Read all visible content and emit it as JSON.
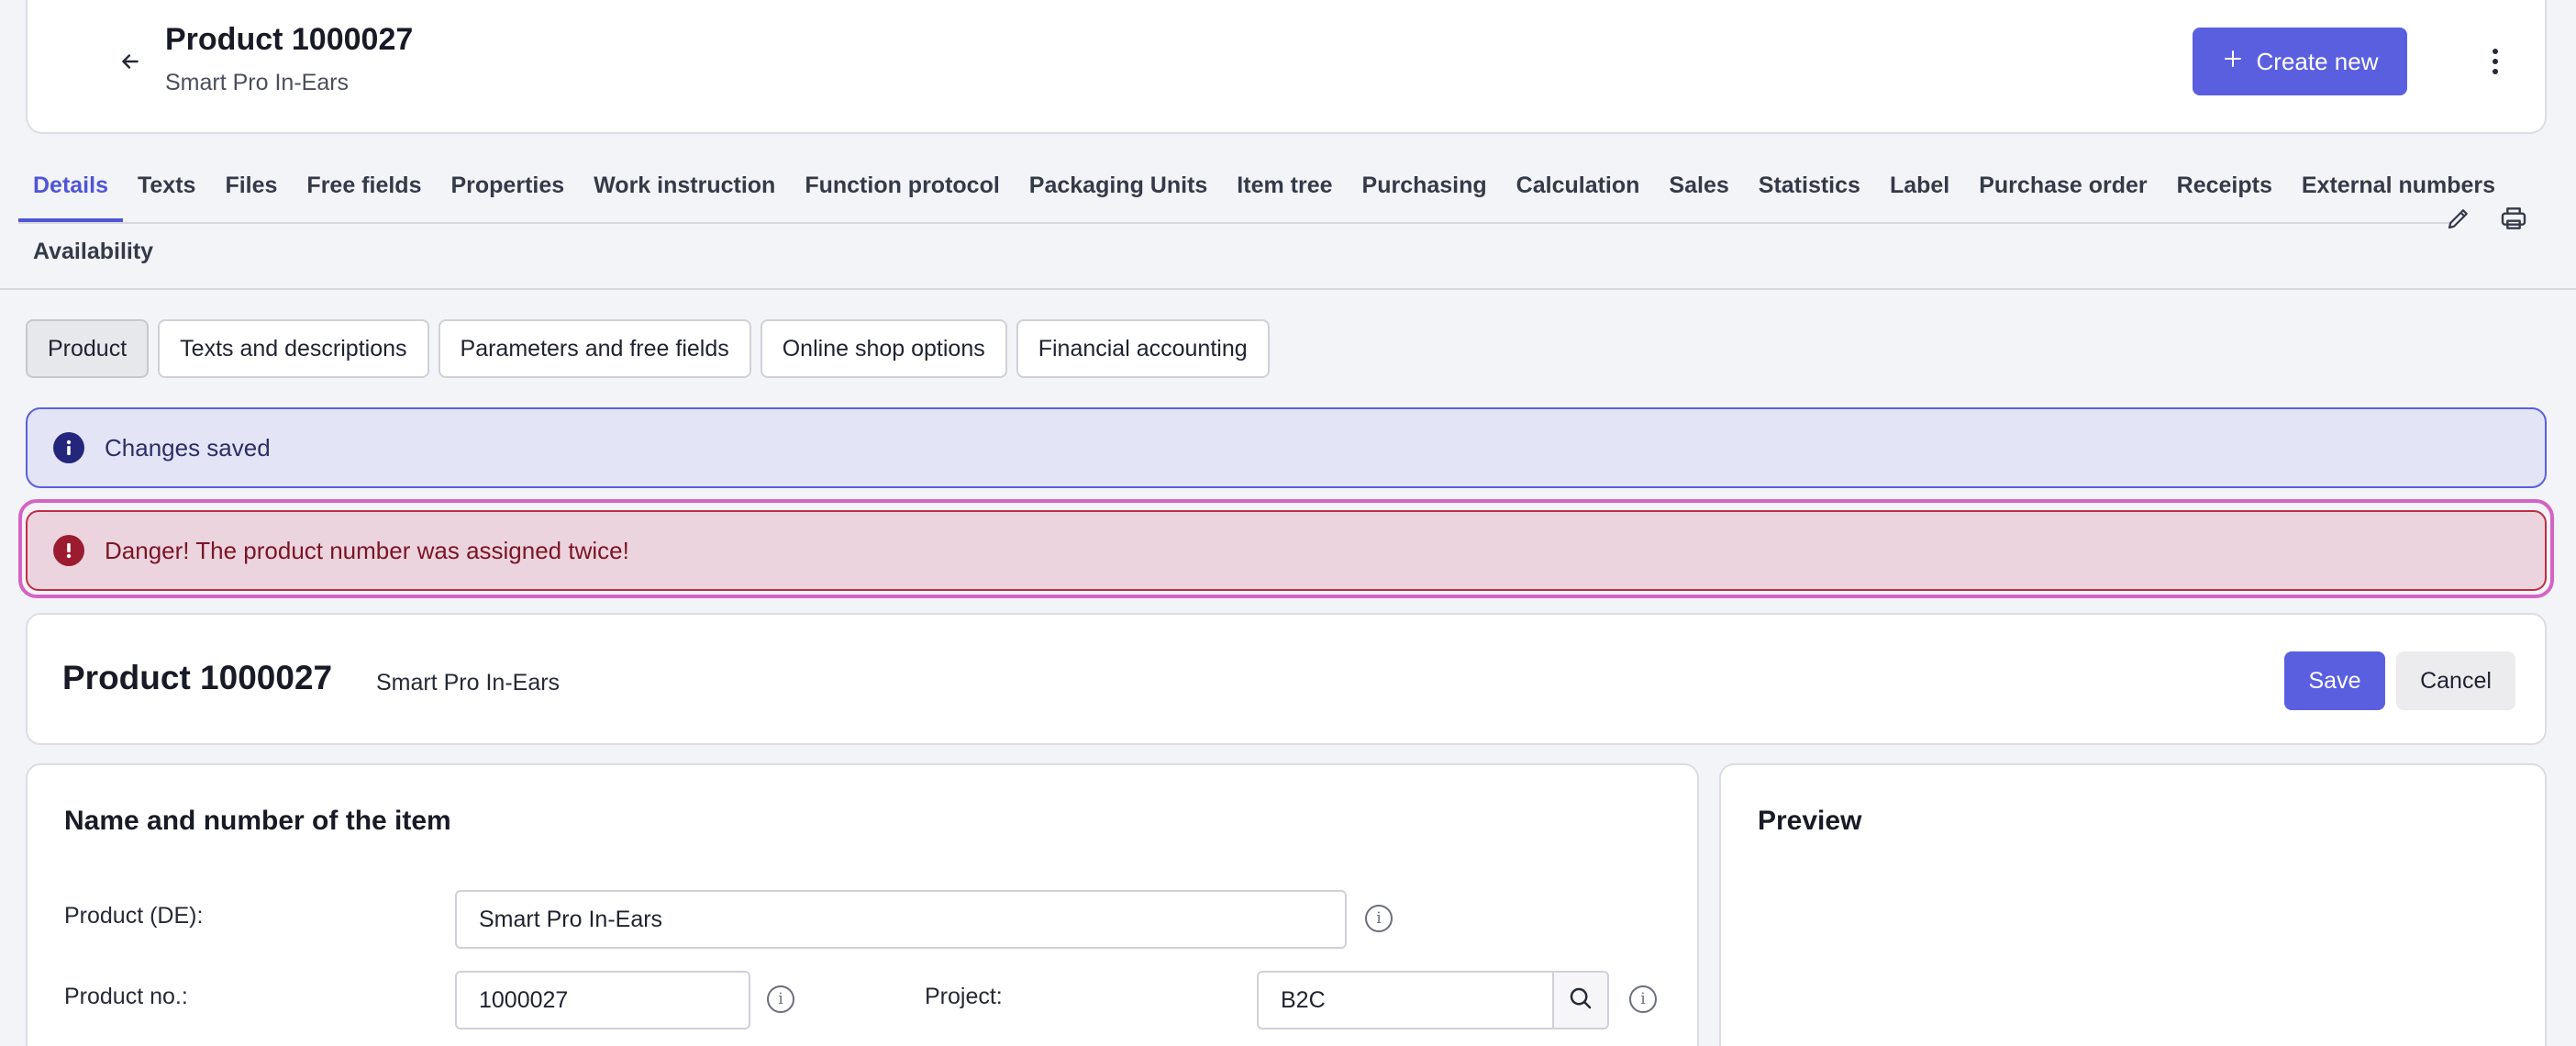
{
  "header": {
    "title": "Product 1000027",
    "subtitle": "Smart Pro In-Ears",
    "create_label": "Create new",
    "back_icon": "arrow-left-icon",
    "more_icon": "kebab-vertical-icon"
  },
  "tabs": [
    {
      "label": "Details"
    },
    {
      "label": "Texts"
    },
    {
      "label": "Files"
    },
    {
      "label": "Free fields"
    },
    {
      "label": "Properties"
    },
    {
      "label": "Work instruction"
    },
    {
      "label": "Function protocol"
    },
    {
      "label": "Packaging Units"
    },
    {
      "label": "Item tree"
    },
    {
      "label": "Purchasing"
    },
    {
      "label": "Calculation"
    },
    {
      "label": "Sales"
    },
    {
      "label": "Statistics"
    },
    {
      "label": "Label"
    },
    {
      "label": "Purchase order"
    },
    {
      "label": "Receipts"
    },
    {
      "label": "External numbers"
    },
    {
      "label": "Availability"
    }
  ],
  "active_tab": "Details",
  "subnav": [
    {
      "label": "Product"
    },
    {
      "label": "Texts and descriptions"
    },
    {
      "label": "Parameters and free fields"
    },
    {
      "label": "Online shop options"
    },
    {
      "label": "Financial accounting"
    }
  ],
  "alerts": {
    "info": "Changes saved",
    "danger": "Danger! The product number was assigned twice!"
  },
  "product_bar": {
    "title": "Product 1000027",
    "subtitle": "Smart Pro In-Ears",
    "save_label": "Save",
    "cancel_label": "Cancel"
  },
  "form": {
    "section_title": "Name and number of the item",
    "product_de_label": "Product (DE):",
    "product_de_value": "Smart Pro In-Ears",
    "product_no_label": "Product no.:",
    "product_no_value": "1000027",
    "project_label": "Project:",
    "project_value": "B2C"
  },
  "preview": {
    "title": "Preview"
  },
  "colors": {
    "accent": "#5a5fe0",
    "info_bg": "#e3e4f6",
    "danger_bg": "#ecd4de",
    "danger_border": "#c02c45",
    "focus_ring": "#d463c6"
  }
}
